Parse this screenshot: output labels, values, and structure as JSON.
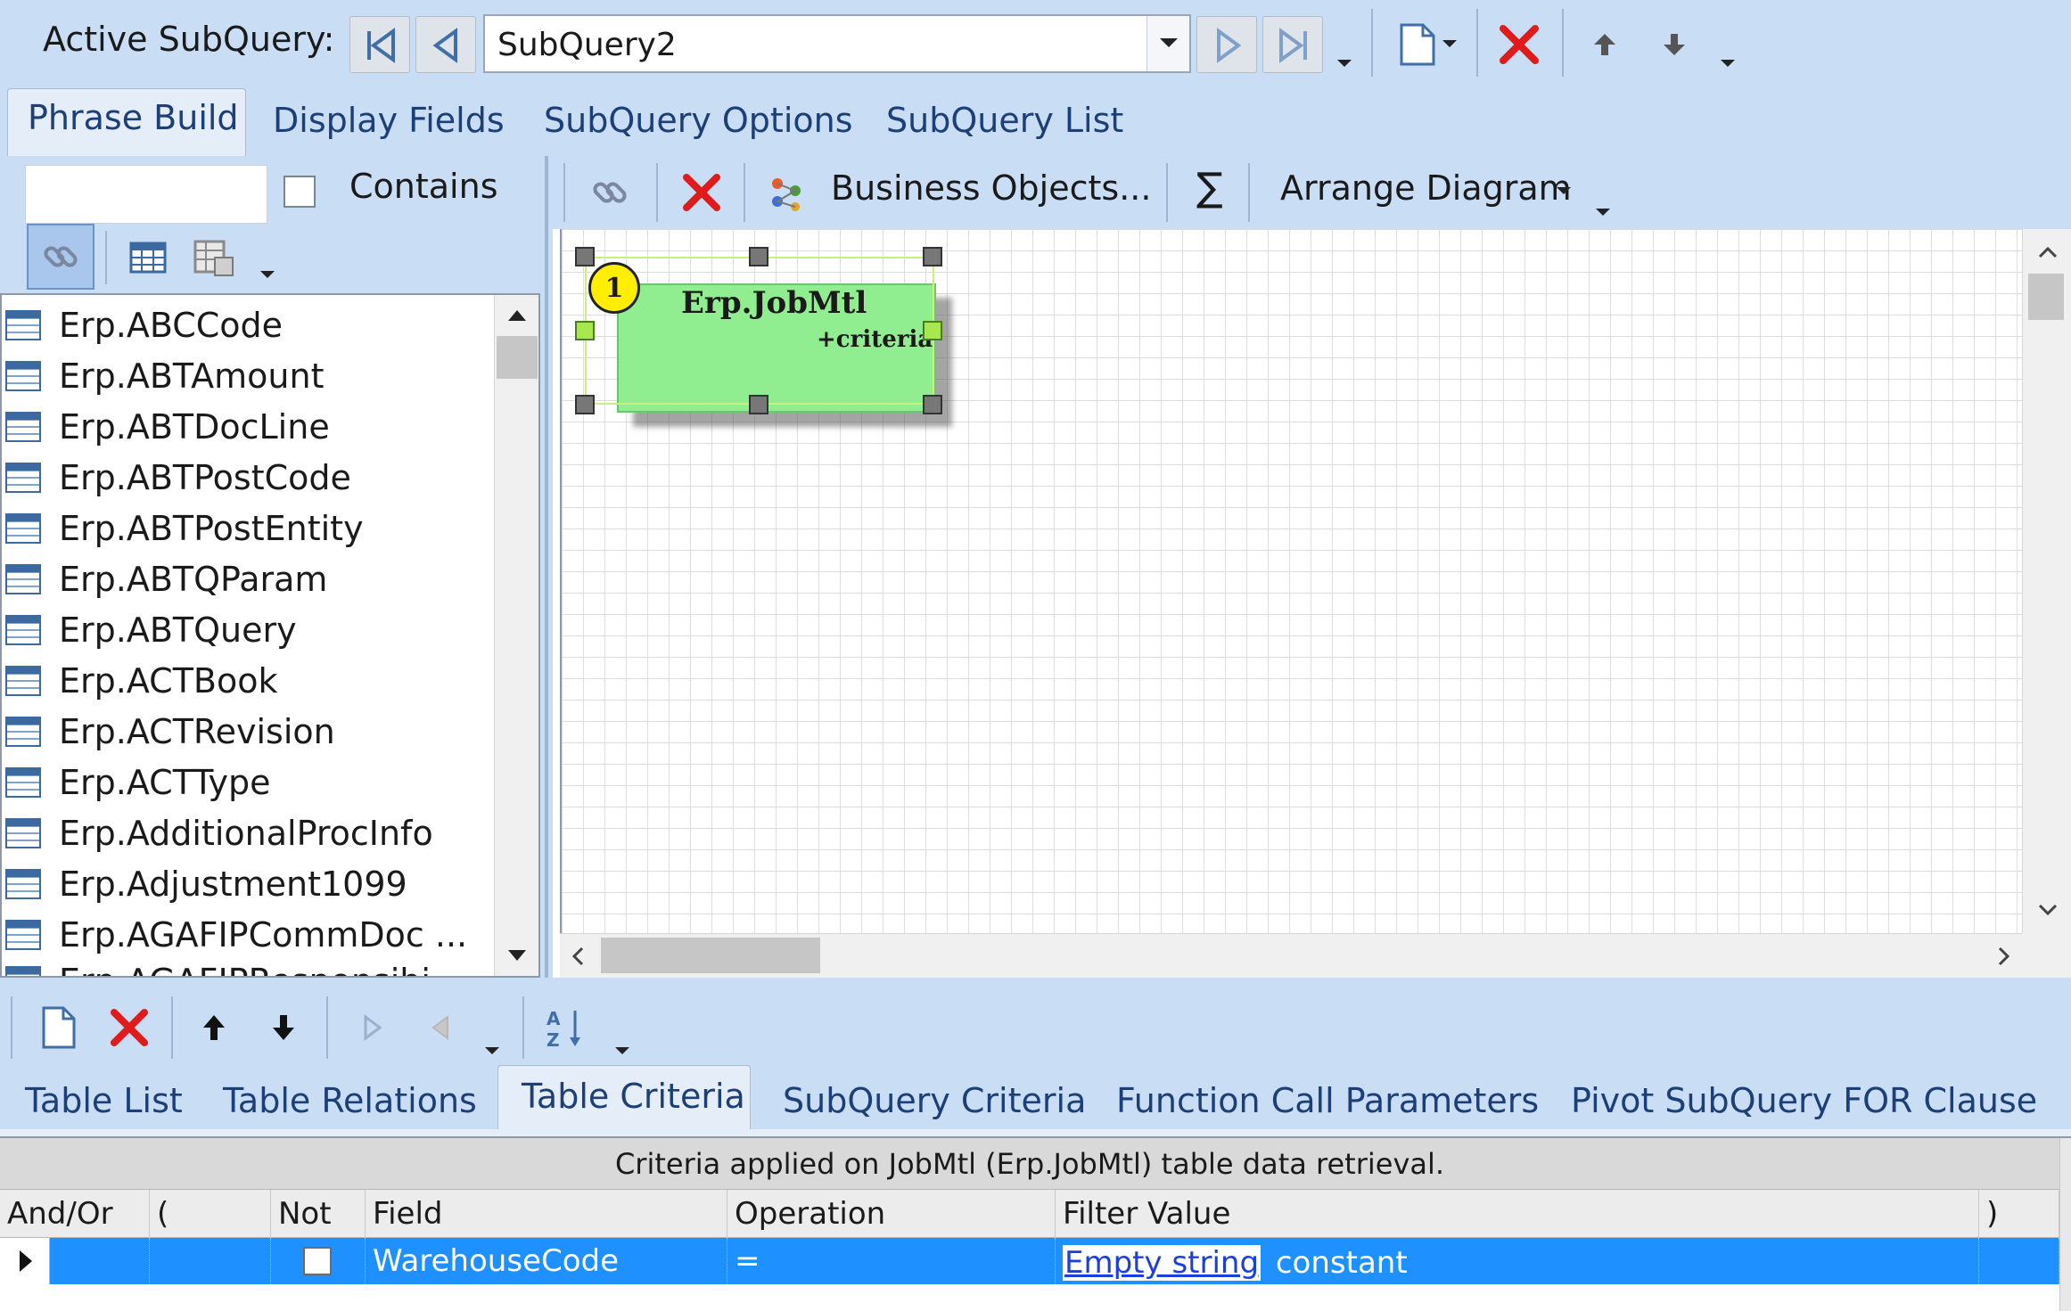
{
  "top_toolbar": {
    "active_subquery_label": "Active SubQuery:",
    "subquery_value": "SubQuery2"
  },
  "main_tabs": [
    {
      "label": "Phrase Build",
      "active": true
    },
    {
      "label": "Display Fields",
      "active": false
    },
    {
      "label": "SubQuery Options",
      "active": false
    },
    {
      "label": "SubQuery List",
      "active": false
    }
  ],
  "left_panel": {
    "search_value": "",
    "contains_label": "Contains",
    "contains_checked": false,
    "tables": [
      "Erp.ABCCode",
      "Erp.ABTAmount",
      "Erp.ABTDocLine",
      "Erp.ABTPostCode",
      "Erp.ABTPostEntity",
      "Erp.ABTQParam",
      "Erp.ABTQuery",
      "Erp.ACTBook",
      "Erp.ACTRevision",
      "Erp.ACTType",
      "Erp.AdditionalProcInfo",
      "Erp.Adjustment1099",
      "Erp.AGAFIPCommDoc ...",
      "Erp.AGAFIPResponsibi..."
    ]
  },
  "diagram_toolbar": {
    "business_objects_label": "Business Objects...",
    "sum_symbol": "∑",
    "arrange_label": "Arrange Diagram"
  },
  "diagram": {
    "node": {
      "badge": "1",
      "title": "Erp.JobMtl",
      "subtitle": "+criteria"
    }
  },
  "bottom_tabs": [
    {
      "label": "Table List",
      "active": false
    },
    {
      "label": "Table Relations",
      "active": false
    },
    {
      "label": "Table Criteria",
      "active": true
    },
    {
      "label": "SubQuery Criteria",
      "active": false
    },
    {
      "label": "Function Call Parameters",
      "active": false
    },
    {
      "label": "Pivot SubQuery FOR Clause",
      "active": false
    }
  ],
  "criteria_grid": {
    "caption": "Criteria applied on JobMtl (Erp.JobMtl)  table data retrieval.",
    "columns": [
      "And/Or",
      "(",
      "Not",
      "Field",
      "Operation",
      "Filter Value",
      ")"
    ],
    "rows": [
      {
        "and_or": "",
        "open_paren": "",
        "not": false,
        "field": "WarehouseCode",
        "operation": "=",
        "filter_link": "Empty string",
        "filter_suffix": "constant",
        "close_paren": ""
      }
    ]
  },
  "colors": {
    "panel_blue": "#c9ddf5",
    "node_green": "#90ee90",
    "selected_row": "#1e90ff",
    "delete_red": "#e01b1b",
    "tab_text": "#1c3f78"
  }
}
